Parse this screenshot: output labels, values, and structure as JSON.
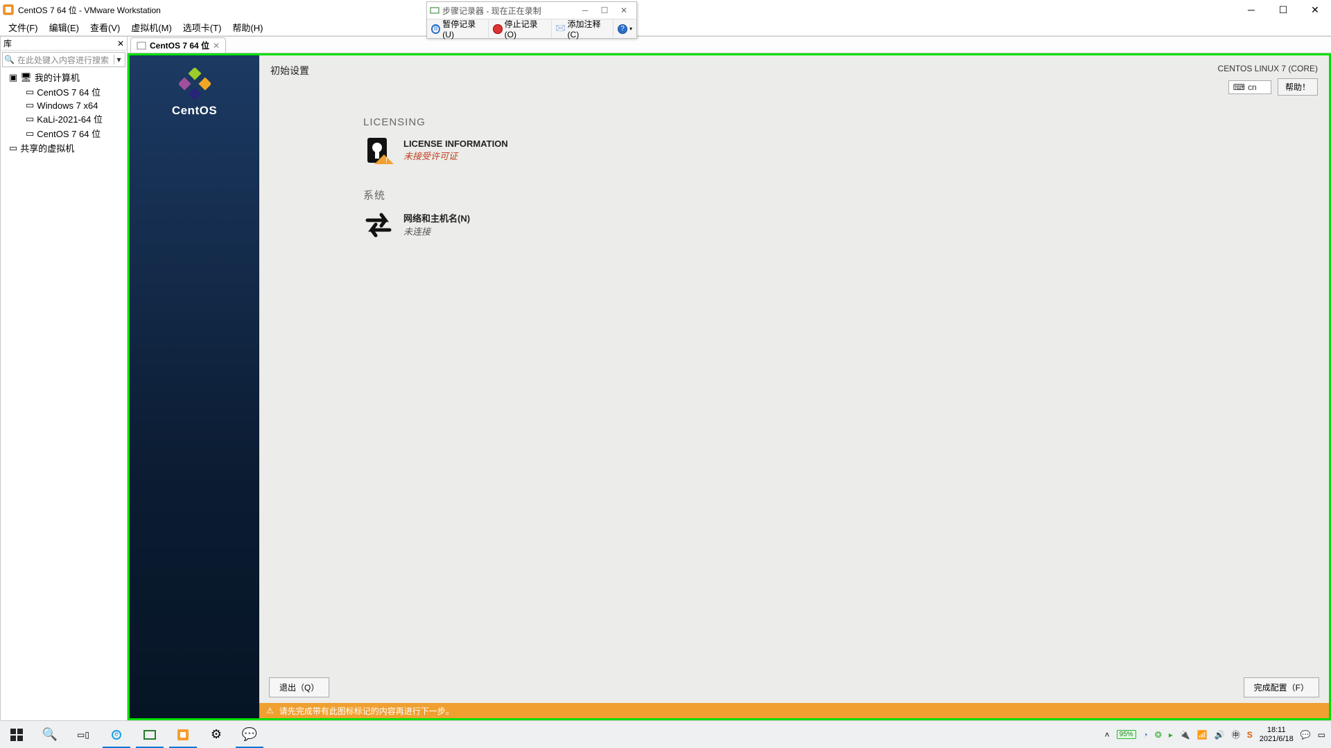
{
  "window": {
    "title": "CentOS 7 64 位 - VMware Workstation"
  },
  "recorder": {
    "title": "步骤记录器 - 现在正在录制",
    "pause": "暂停记录(U)",
    "stop": "停止记录(O)",
    "comment": "添加注释(C)"
  },
  "menu": {
    "file": "文件(F)",
    "edit": "编辑(E)",
    "view": "查看(V)",
    "vm": "虚拟机(M)",
    "tabs": "选项卡(T)",
    "help": "帮助(H)"
  },
  "library": {
    "title": "库",
    "search_placeholder": "在此处键入内容进行搜索",
    "root": "我的计算机",
    "items": [
      "CentOS 7 64 位",
      "Windows 7 x64",
      "KaLi-2021-64 位",
      "CentOS 7 64 位"
    ],
    "shared": "共享的虚拟机"
  },
  "tab": {
    "label": "CentOS 7 64 位"
  },
  "vm": {
    "brand": "CentOS",
    "header_left": "初始设置",
    "header_right": "CENTOS LINUX 7 (CORE)",
    "lang": "cn",
    "help": "帮助！",
    "sections": {
      "licensing": "LICENSING",
      "license_info": "LICENSE INFORMATION",
      "license_status": "未接受许可证",
      "system": "系统",
      "network": "网络和主机名(N)",
      "network_status": "未连接"
    },
    "quit": "退出（Q）",
    "finish": "完成配置（F）",
    "warning": "请先完成带有此图标标记的内容再进行下一步。"
  },
  "taskbar": {
    "battery": "95%",
    "time": "18:11",
    "date": "2021/6/18"
  }
}
